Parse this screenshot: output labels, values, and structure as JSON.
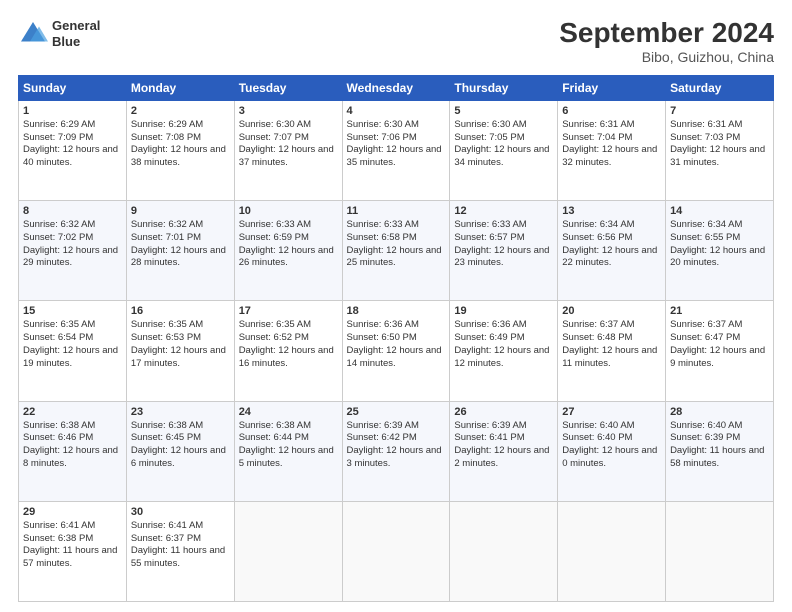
{
  "header": {
    "logo_line1": "General",
    "logo_line2": "Blue",
    "title": "September 2024",
    "subtitle": "Bibo, Guizhou, China"
  },
  "days_of_week": [
    "Sunday",
    "Monday",
    "Tuesday",
    "Wednesday",
    "Thursday",
    "Friday",
    "Saturday"
  ],
  "weeks": [
    [
      {
        "day": 1,
        "sunrise": "6:29 AM",
        "sunset": "7:09 PM",
        "daylight": "12 hours and 40 minutes."
      },
      {
        "day": 2,
        "sunrise": "6:29 AM",
        "sunset": "7:08 PM",
        "daylight": "12 hours and 38 minutes."
      },
      {
        "day": 3,
        "sunrise": "6:30 AM",
        "sunset": "7:07 PM",
        "daylight": "12 hours and 37 minutes."
      },
      {
        "day": 4,
        "sunrise": "6:30 AM",
        "sunset": "7:06 PM",
        "daylight": "12 hours and 35 minutes."
      },
      {
        "day": 5,
        "sunrise": "6:30 AM",
        "sunset": "7:05 PM",
        "daylight": "12 hours and 34 minutes."
      },
      {
        "day": 6,
        "sunrise": "6:31 AM",
        "sunset": "7:04 PM",
        "daylight": "12 hours and 32 minutes."
      },
      {
        "day": 7,
        "sunrise": "6:31 AM",
        "sunset": "7:03 PM",
        "daylight": "12 hours and 31 minutes."
      }
    ],
    [
      {
        "day": 8,
        "sunrise": "6:32 AM",
        "sunset": "7:02 PM",
        "daylight": "12 hours and 29 minutes."
      },
      {
        "day": 9,
        "sunrise": "6:32 AM",
        "sunset": "7:01 PM",
        "daylight": "12 hours and 28 minutes."
      },
      {
        "day": 10,
        "sunrise": "6:33 AM",
        "sunset": "6:59 PM",
        "daylight": "12 hours and 26 minutes."
      },
      {
        "day": 11,
        "sunrise": "6:33 AM",
        "sunset": "6:58 PM",
        "daylight": "12 hours and 25 minutes."
      },
      {
        "day": 12,
        "sunrise": "6:33 AM",
        "sunset": "6:57 PM",
        "daylight": "12 hours and 23 minutes."
      },
      {
        "day": 13,
        "sunrise": "6:34 AM",
        "sunset": "6:56 PM",
        "daylight": "12 hours and 22 minutes."
      },
      {
        "day": 14,
        "sunrise": "6:34 AM",
        "sunset": "6:55 PM",
        "daylight": "12 hours and 20 minutes."
      }
    ],
    [
      {
        "day": 15,
        "sunrise": "6:35 AM",
        "sunset": "6:54 PM",
        "daylight": "12 hours and 19 minutes."
      },
      {
        "day": 16,
        "sunrise": "6:35 AM",
        "sunset": "6:53 PM",
        "daylight": "12 hours and 17 minutes."
      },
      {
        "day": 17,
        "sunrise": "6:35 AM",
        "sunset": "6:52 PM",
        "daylight": "12 hours and 16 minutes."
      },
      {
        "day": 18,
        "sunrise": "6:36 AM",
        "sunset": "6:50 PM",
        "daylight": "12 hours and 14 minutes."
      },
      {
        "day": 19,
        "sunrise": "6:36 AM",
        "sunset": "6:49 PM",
        "daylight": "12 hours and 12 minutes."
      },
      {
        "day": 20,
        "sunrise": "6:37 AM",
        "sunset": "6:48 PM",
        "daylight": "12 hours and 11 minutes."
      },
      {
        "day": 21,
        "sunrise": "6:37 AM",
        "sunset": "6:47 PM",
        "daylight": "12 hours and 9 minutes."
      }
    ],
    [
      {
        "day": 22,
        "sunrise": "6:38 AM",
        "sunset": "6:46 PM",
        "daylight": "12 hours and 8 minutes."
      },
      {
        "day": 23,
        "sunrise": "6:38 AM",
        "sunset": "6:45 PM",
        "daylight": "12 hours and 6 minutes."
      },
      {
        "day": 24,
        "sunrise": "6:38 AM",
        "sunset": "6:44 PM",
        "daylight": "12 hours and 5 minutes."
      },
      {
        "day": 25,
        "sunrise": "6:39 AM",
        "sunset": "6:42 PM",
        "daylight": "12 hours and 3 minutes."
      },
      {
        "day": 26,
        "sunrise": "6:39 AM",
        "sunset": "6:41 PM",
        "daylight": "12 hours and 2 minutes."
      },
      {
        "day": 27,
        "sunrise": "6:40 AM",
        "sunset": "6:40 PM",
        "daylight": "12 hours and 0 minutes."
      },
      {
        "day": 28,
        "sunrise": "6:40 AM",
        "sunset": "6:39 PM",
        "daylight": "11 hours and 58 minutes."
      }
    ],
    [
      {
        "day": 29,
        "sunrise": "6:41 AM",
        "sunset": "6:38 PM",
        "daylight": "11 hours and 57 minutes."
      },
      {
        "day": 30,
        "sunrise": "6:41 AM",
        "sunset": "6:37 PM",
        "daylight": "11 hours and 55 minutes."
      },
      null,
      null,
      null,
      null,
      null
    ]
  ]
}
